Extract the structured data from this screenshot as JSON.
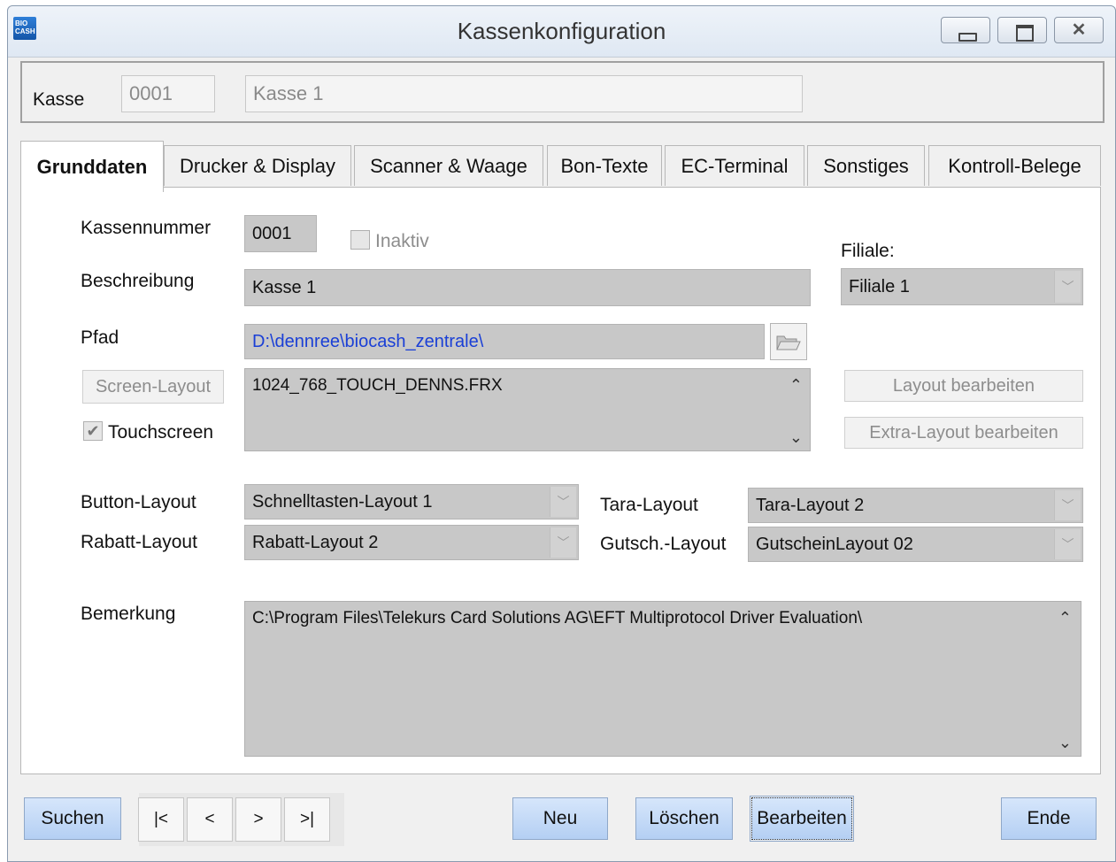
{
  "window": {
    "title": "Kassenkonfiguration",
    "icon_text": "BIO CASH",
    "controls": [
      "minimize-icon",
      "maximize-icon",
      "close-icon"
    ]
  },
  "header": {
    "kasse_label": "Kasse",
    "kasse_number": "0001",
    "kasse_name": "Kasse 1"
  },
  "tabs": [
    {
      "label": "Grunddaten",
      "active": true
    },
    {
      "label": "Drucker & Display"
    },
    {
      "label": "Scanner & Waage"
    },
    {
      "label": "Bon-Texte"
    },
    {
      "label": "EC-Terminal"
    },
    {
      "label": "Sonstiges"
    },
    {
      "label": "Kontroll-Belege"
    }
  ],
  "form": {
    "kassennummer_label": "Kassennummer",
    "kassennummer_value": "0001",
    "inaktiv_label": "Inaktiv",
    "filiale_label": "Filiale:",
    "filiale_value": "Filiale 1",
    "beschreibung_label": "Beschreibung",
    "beschreibung_value": "Kasse 1",
    "pfad_label": "Pfad",
    "pfad_value": "D:\\dennree\\biocash_zentrale\\",
    "screen_layout_button": "Screen-Layout",
    "screen_layout_value": "1024_768_TOUCH_DENNS.FRX",
    "touchscreen_label": "Touchscreen",
    "layout_bearbeiten_button": "Layout bearbeiten",
    "extra_layout_bearbeiten_button": "Extra-Layout bearbeiten",
    "button_layout_label": "Button-Layout",
    "button_layout_value": "Schnelltasten-Layout 1",
    "tara_layout_label": "Tara-Layout",
    "tara_layout_value": "Tara-Layout 2",
    "rabatt_layout_label": "Rabatt-Layout",
    "rabatt_layout_value": "Rabatt-Layout 2",
    "gutsch_layout_label": "Gutsch.-Layout",
    "gutsch_layout_value": "GutscheinLayout 02",
    "bemerkung_label": "Bemerkung",
    "bemerkung_value": "C:\\Program Files\\Telekurs Card Solutions AG\\EFT Multiprotocol Driver Evaluation\\"
  },
  "footer": {
    "suchen": "Suchen",
    "nav_first": "|<",
    "nav_prev": "<",
    "nav_next": ">",
    "nav_last": ">|",
    "neu": "Neu",
    "loeschen": "Löschen",
    "bearbeiten": "Bearbeiten",
    "ende": "Ende"
  },
  "colors": {
    "field_bg": "#c8c8c8",
    "path_text": "#1a3fd6",
    "button_blue": "#b4cff3"
  }
}
